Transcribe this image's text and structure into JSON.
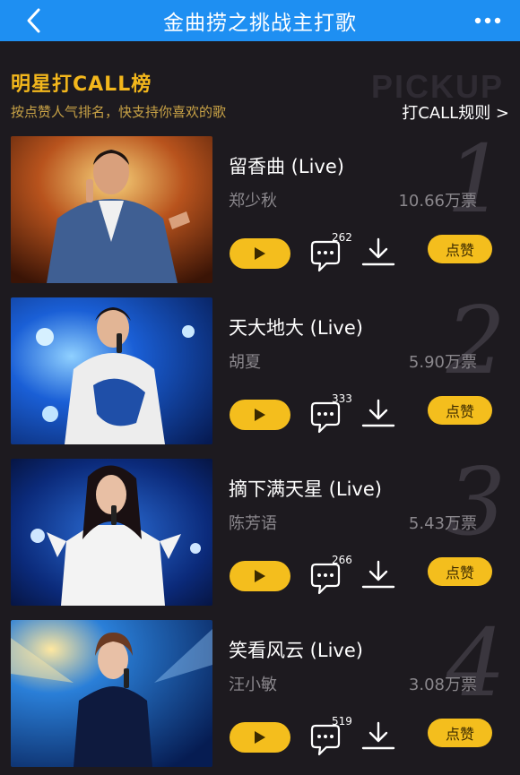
{
  "header": {
    "title": "金曲捞之挑战主打歌"
  },
  "icons": {
    "back": "chevron-left-icon",
    "more": "more-dots-icon"
  },
  "section": {
    "title": "明星打CALL榜",
    "subtitle": "按点赞人气排名，快支持你喜欢的歌",
    "bg_word": "PICKUP",
    "rules_link": "打CALL规则 >"
  },
  "colors": {
    "topbar": "#1e8ff2",
    "accent": "#f4be1d",
    "background": "#1d1a1f"
  },
  "items": [
    {
      "rank": "1",
      "song": "留香曲 (Live)",
      "artist": "郑少秋",
      "votes": "10.66万票",
      "comments": "262",
      "like_label": "点赞"
    },
    {
      "rank": "2",
      "song": "天大地大 (Live)",
      "artist": "胡夏",
      "votes": "5.90万票",
      "comments": "333",
      "like_label": "点赞"
    },
    {
      "rank": "3",
      "song": "摘下满天星 (Live)",
      "artist": "陈芳语",
      "votes": "5.43万票",
      "comments": "266",
      "like_label": "点赞"
    },
    {
      "rank": "4",
      "song": "笑看风云 (Live)",
      "artist": "汪小敏",
      "votes": "3.08万票",
      "comments": "519",
      "like_label": "点赞"
    }
  ]
}
